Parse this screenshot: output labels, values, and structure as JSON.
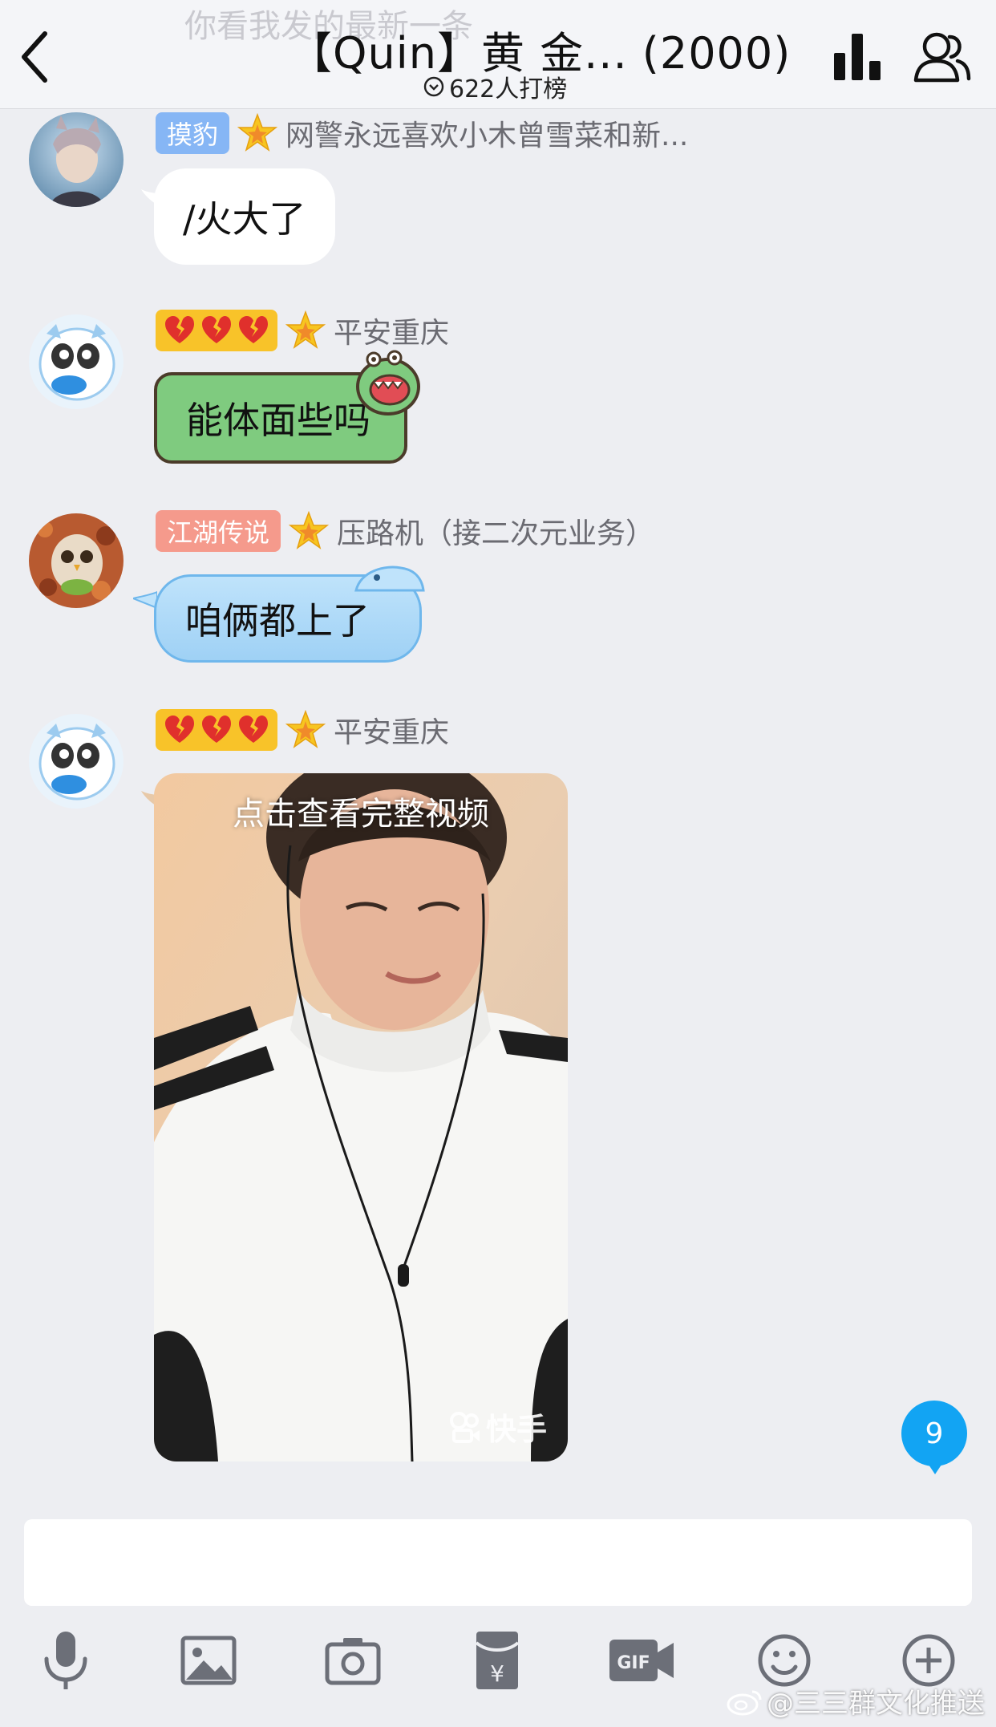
{
  "header": {
    "ghost_text": "你看我发的最新一条",
    "title": "【Quin】黄 金... (2000)",
    "subtitle": "622人打榜",
    "back_icon": "chevron-left-icon",
    "rank_icon": "bar-chart-icon",
    "members_icon": "group-members-icon"
  },
  "messages": [
    {
      "badge": "摸豹",
      "badge_color": "#86b6f5",
      "nickname": "网警永远喜欢小木曾雪菜和新...",
      "text": "/火大了",
      "bubble": "plain"
    },
    {
      "badge_hearts": 3,
      "nickname": "平安重庆",
      "text": "能体面些吗",
      "bubble": "green-monster"
    },
    {
      "badge": "江湖传说",
      "badge_color": "#f59a8c",
      "nickname": "压路机（接二次元业务）",
      "text": "咱俩都上了",
      "bubble": "blue-whale"
    },
    {
      "badge_hearts": 3,
      "nickname": "平安重庆",
      "video": {
        "caption": "点击查看完整视频",
        "watermark": "快手"
      }
    }
  ],
  "unread_count": "9",
  "input": {
    "placeholder": ""
  },
  "toolbar": {
    "items": [
      "microphone-icon",
      "image-icon",
      "camera-icon",
      "red-packet-icon",
      "gif-icon",
      "emoji-icon",
      "plus-icon"
    ]
  },
  "watermark": "@三三群文化推送",
  "colors": {
    "background": "#edeef2",
    "accent_blue": "#12a4f3",
    "heart_badge": "#f8c329",
    "green_bubble": "#7fcb7f"
  }
}
